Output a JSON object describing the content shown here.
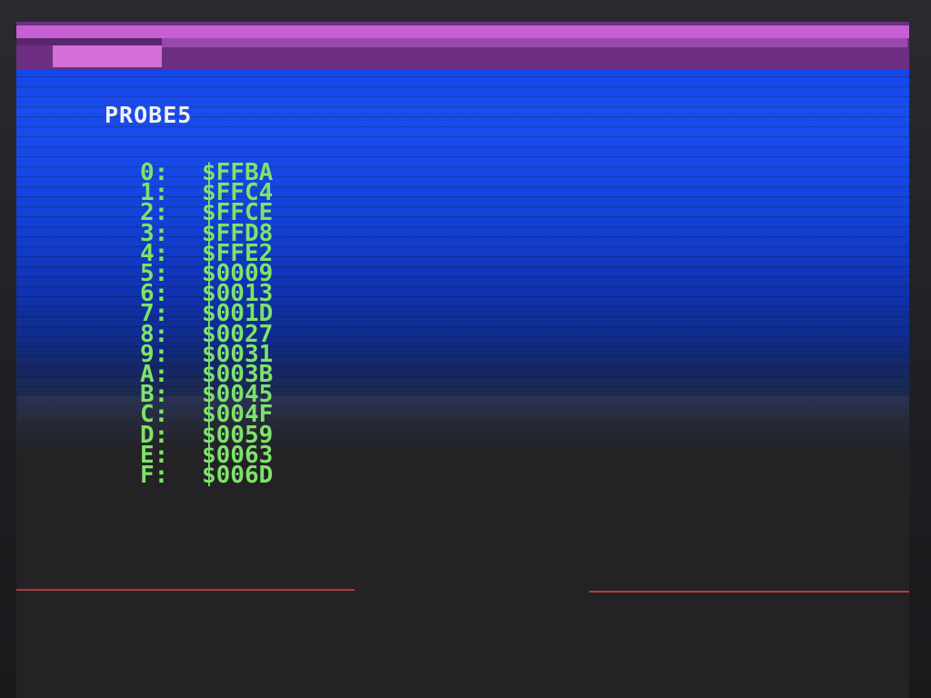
{
  "screen": {
    "title": "PROBE5",
    "rows": [
      {
        "index": "0:",
        "value": "$FFBA"
      },
      {
        "index": "1:",
        "value": "$FFC4"
      },
      {
        "index": "2:",
        "value": "$FFCE"
      },
      {
        "index": "3:",
        "value": "$FFD8"
      },
      {
        "index": "4:",
        "value": "$FFE2"
      },
      {
        "index": "5:",
        "value": "$0009"
      },
      {
        "index": "6:",
        "value": "$0013"
      },
      {
        "index": "7:",
        "value": "$001D"
      },
      {
        "index": "8:",
        "value": "$0027"
      },
      {
        "index": "9:",
        "value": "$0031"
      },
      {
        "index": "A:",
        "value": "$003B"
      },
      {
        "index": "B:",
        "value": "$0045"
      },
      {
        "index": "C:",
        "value": "$004F"
      },
      {
        "index": "D:",
        "value": "$0059"
      },
      {
        "index": "E:",
        "value": "$0063"
      },
      {
        "index": "F:",
        "value": "$006D"
      }
    ]
  },
  "colors": {
    "border": "#c65fd2",
    "paper": "#1446e8",
    "text_title": "#f1f1f1",
    "text_values": "#7ee36a",
    "scanline": "#b33a3a"
  }
}
